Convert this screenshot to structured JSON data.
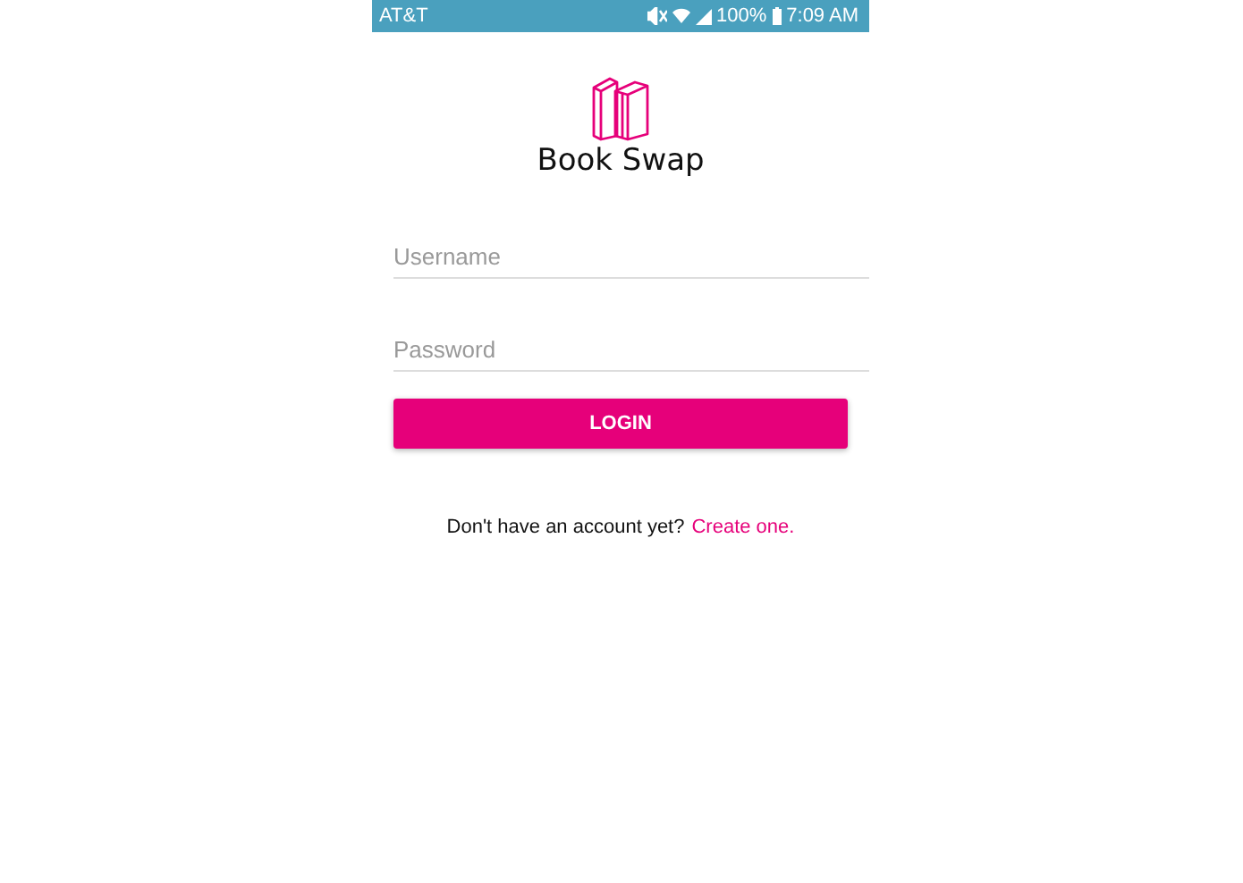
{
  "status_bar": {
    "carrier": "AT&T",
    "battery": "100%",
    "time": "7:09 AM"
  },
  "app": {
    "title": "Book Swap"
  },
  "form": {
    "fields": [
      {
        "placeholder": "Username"
      },
      {
        "placeholder": "Password"
      }
    ],
    "button": "LOGIN"
  },
  "footer": {
    "prompt": "Don't have an account yet?",
    "link": "Create one."
  }
}
